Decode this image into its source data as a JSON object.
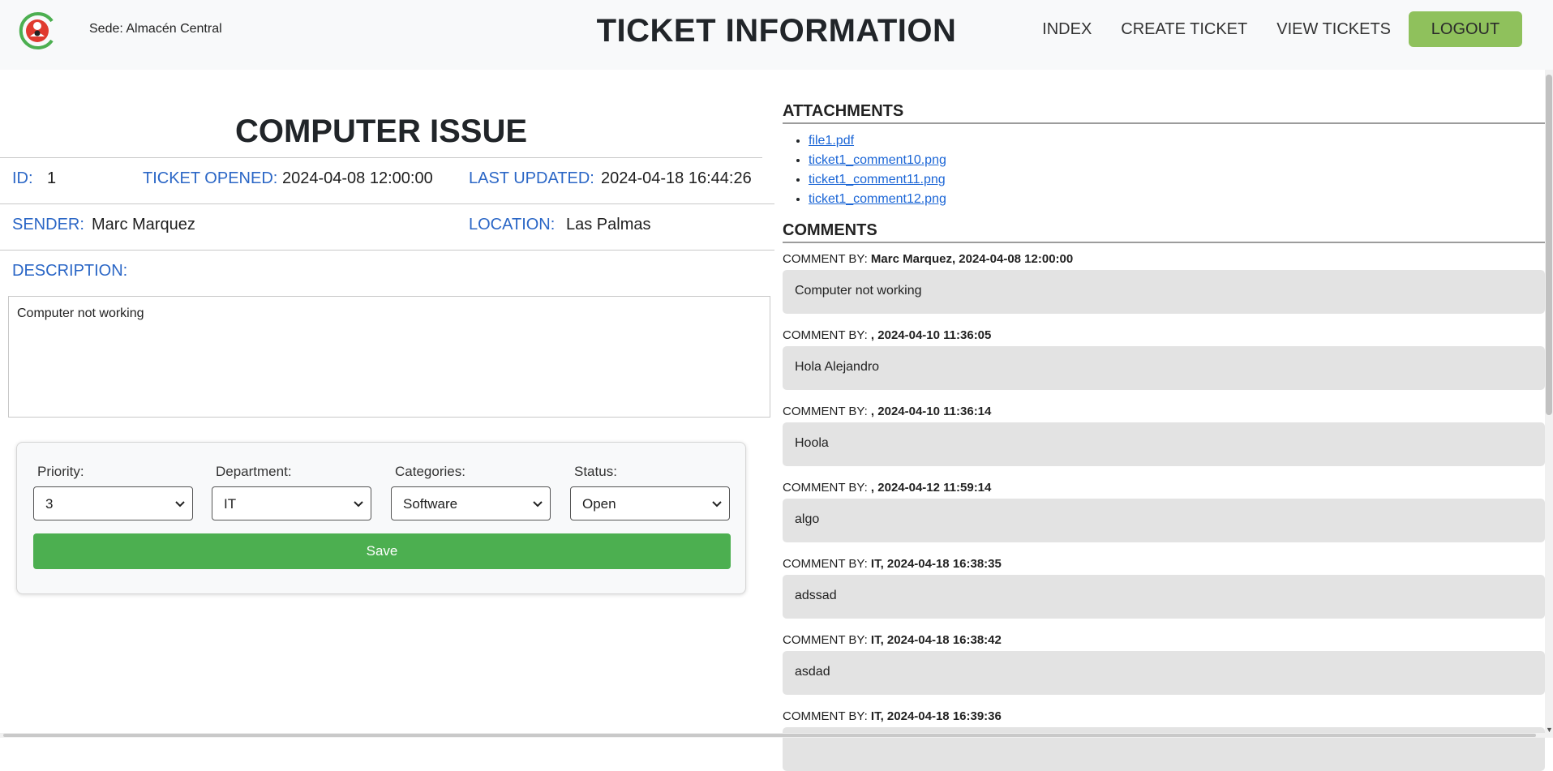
{
  "header": {
    "sede": "Sede: Almacén Central",
    "title": "TICKET INFORMATION",
    "nav": [
      "INDEX",
      "CREATE TICKET",
      "VIEW TICKETS"
    ],
    "logout": "LOGOUT",
    "colors": {
      "logout_bg": "#8fc15c",
      "bar_bg": "#f8f9fa"
    }
  },
  "ticket": {
    "title": "COMPUTER ISSUE",
    "id_label": "ID:",
    "id_value": "1",
    "opened_label": "TICKET OPENED:",
    "opened_value": "2024-04-08 12:00:00",
    "updated_label": "LAST UPDATED:",
    "updated_value": "2024-04-18 16:44:26",
    "sender_label": "SENDER:",
    "sender_value": "Marc Marquez",
    "location_label": "LOCATION:",
    "location_value": "Las Palmas",
    "description_label": "DESCRIPTION:",
    "description": "Computer not working"
  },
  "controls": {
    "priority": {
      "label": "Priority:",
      "value": "3"
    },
    "department": {
      "label": "Department:",
      "value": "IT"
    },
    "categories": {
      "label": "Categories:",
      "value": "Software"
    },
    "status": {
      "label": "Status:",
      "value": "Open"
    },
    "save": "Save",
    "save_color": "#4caf50"
  },
  "attachments": {
    "title": "ATTACHMENTS",
    "files": [
      "file1.pdf",
      "ticket1_comment10.png",
      "ticket1_comment11.png",
      "ticket1_comment12.png"
    ]
  },
  "comments": {
    "title": "COMMENTS",
    "by_label": "COMMENT BY:",
    "items": [
      {
        "meta": "Marc Marquez, 2024-04-08 12:00:00",
        "text": "Computer not working"
      },
      {
        "meta": ", 2024-04-10 11:36:05",
        "text": "Hola Alejandro"
      },
      {
        "meta": ", 2024-04-10 11:36:14",
        "text": "Hoola"
      },
      {
        "meta": ", 2024-04-12 11:59:14",
        "text": "algo"
      },
      {
        "meta": "IT, 2024-04-18 16:38:35",
        "text": "adssad"
      },
      {
        "meta": "IT, 2024-04-18 16:38:42",
        "text": "asdad"
      },
      {
        "meta": "IT, 2024-04-18 16:39:36",
        "text": ""
      }
    ]
  }
}
